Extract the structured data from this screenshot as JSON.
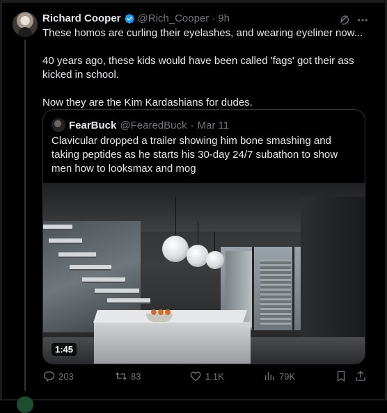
{
  "tweet": {
    "author_name": "Richard Cooper",
    "handle": "@Rich_Cooper",
    "separator": "·",
    "time": "9h",
    "paragraphs": [
      "These homos are curling their eyelashes, and wearing eyeliner now...",
      "40 years ago, these kids would have been called 'fags'  got their ass kicked in school.",
      "Now they are the Kim Kardashians for dudes."
    ]
  },
  "quote": {
    "author_name": "FearBuck",
    "handle": "@FearedBuck",
    "separator": "·",
    "date": "Mar 11",
    "text": "Clavicular dropped a trailer showing him bone smashing and taking peptides as he starts his 30-day 24/7 subathon to show men how to looksmax and mog",
    "video_duration": "1:45"
  },
  "actions": {
    "replies": "203",
    "reposts": "83",
    "likes": "1.1K",
    "views": "79K"
  },
  "colors": {
    "background": "#000000",
    "text": "#e7e9ea",
    "muted": "#71767b",
    "border": "#2f3336",
    "verified": "#1d9bf0"
  },
  "icons": [
    "verified-badge-icon",
    "grok-icon",
    "more-icon",
    "reply-icon",
    "repost-icon",
    "like-icon",
    "views-icon",
    "bookmark-icon",
    "share-icon"
  ]
}
